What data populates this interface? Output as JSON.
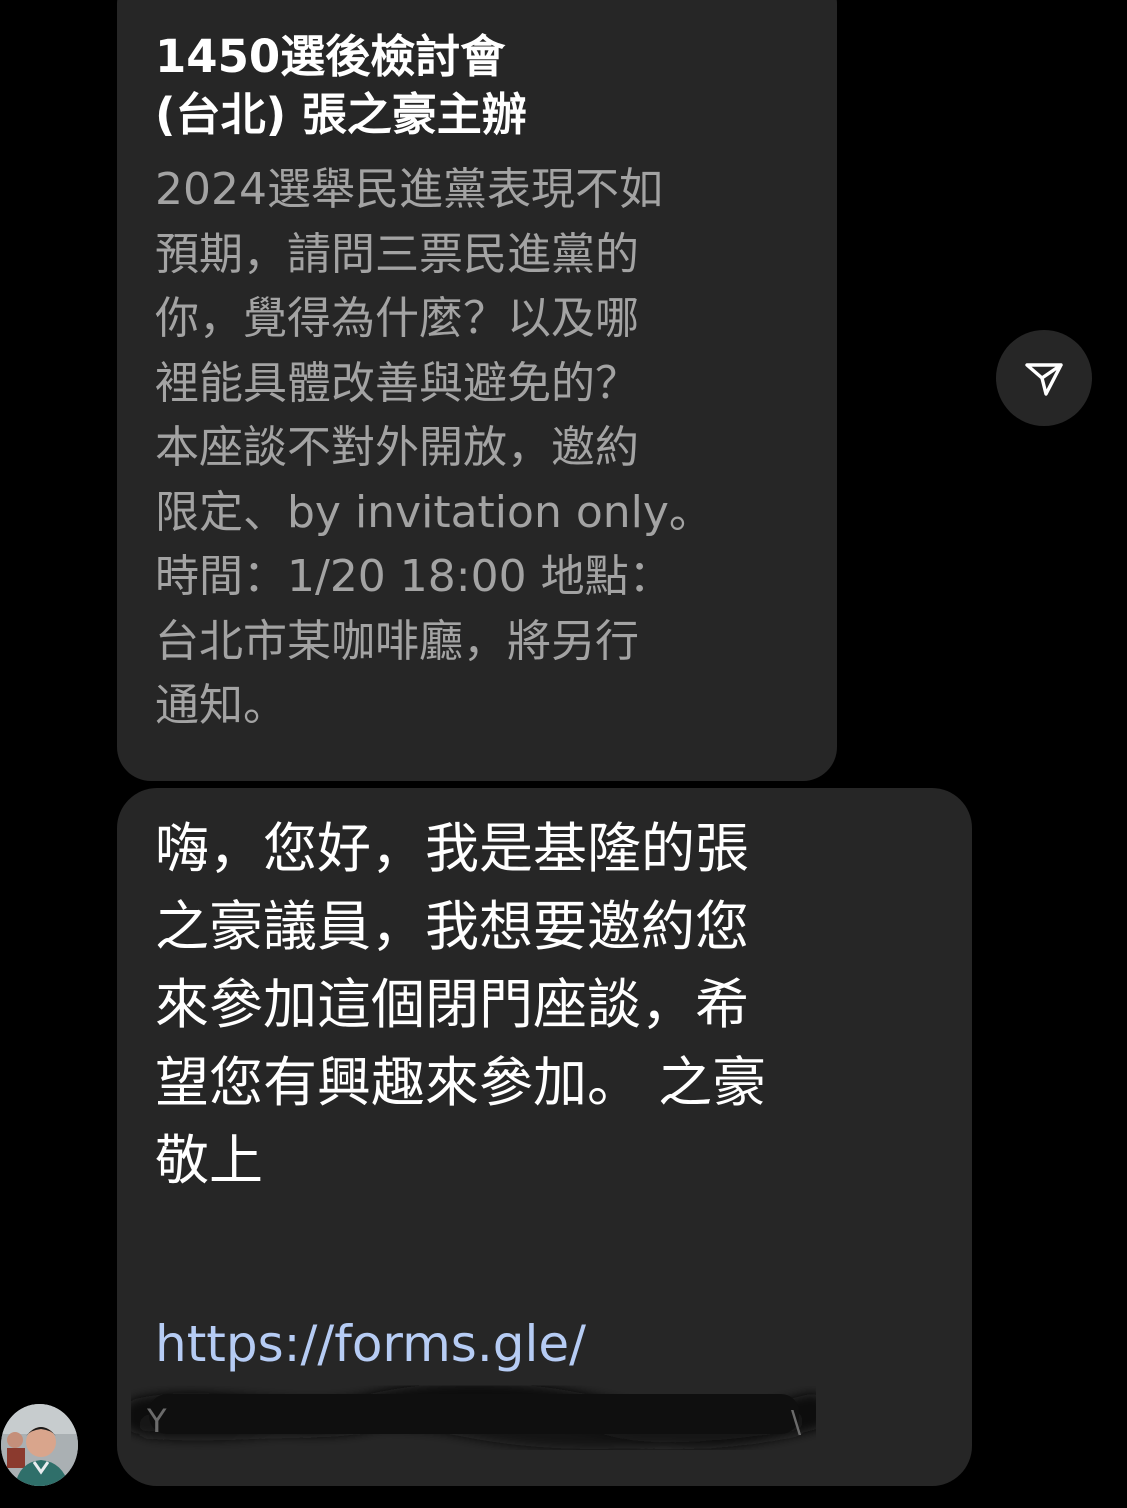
{
  "shared_post": {
    "title": "1450選後檢討會\n(台北) 張之豪主辦",
    "description": "2024選舉民進黨表現不如\n預期，請問三票民進黨的\n你，覺得為什麼？以及哪\n裡能具體改善與避免的？\n本座談不對外開放，邀約\n限定、by invitation only。\n時間：1/20 18:00 地點：\n台北市某咖啡廳，將另行\n通知。"
  },
  "message": {
    "text": "嗨，您好，我是基隆的張\n之豪議員，我想要邀約您\n來參加這個閉門座談，希\n望您有興趣來參加。 之豪\n敬上",
    "link_visible": "https://forms.gle/"
  },
  "icons": {
    "share": "paper-plane-icon",
    "avatar": "sender-avatar"
  },
  "colors": {
    "background": "#000000",
    "bubble": "#262626",
    "title_text": "#ffffff",
    "description_text": "#a3a3a3",
    "link_text": "#b6ccf4"
  }
}
